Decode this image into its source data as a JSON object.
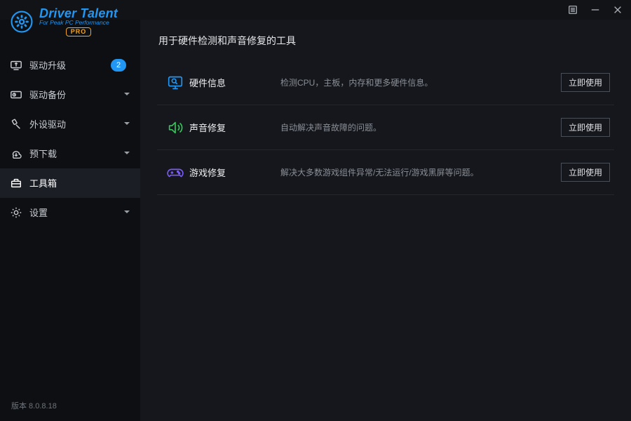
{
  "app": {
    "brand": "Driver Talent",
    "tagline": "For Peak PC Performance",
    "edition": "PRO",
    "version_label": "版本 8.0.8.18"
  },
  "sidebar": {
    "items": [
      {
        "label": "驱动升级",
        "icon": "driver-update-icon",
        "badge": "2",
        "has_submenu": false
      },
      {
        "label": "驱动备份",
        "icon": "driver-backup-icon",
        "has_submenu": true
      },
      {
        "label": "外设驱动",
        "icon": "peripheral-icon",
        "has_submenu": true
      },
      {
        "label": "预下载",
        "icon": "predownload-icon",
        "has_submenu": true
      },
      {
        "label": "工具箱",
        "icon": "toolbox-icon",
        "has_submenu": false,
        "active": true
      },
      {
        "label": "设置",
        "icon": "settings-icon",
        "has_submenu": true
      }
    ]
  },
  "main": {
    "title": "用于硬件检测和声音修复的工具",
    "tools": [
      {
        "name": "硬件信息",
        "desc": "检测CPU，主板，内存和更多硬件信息。",
        "action": "立即使用",
        "icon": "hardware-info-icon",
        "color": "#2196f3"
      },
      {
        "name": "声音修复",
        "desc": "自动解决声音故障的问题。",
        "action": "立即使用",
        "icon": "sound-fix-icon",
        "color": "#34c759"
      },
      {
        "name": "游戏修复",
        "desc": "解决大多数游戏组件异常/无法运行/游戏黑屏等问题。",
        "action": "立即使用",
        "icon": "game-fix-icon",
        "color": "#7a5af8"
      }
    ]
  }
}
